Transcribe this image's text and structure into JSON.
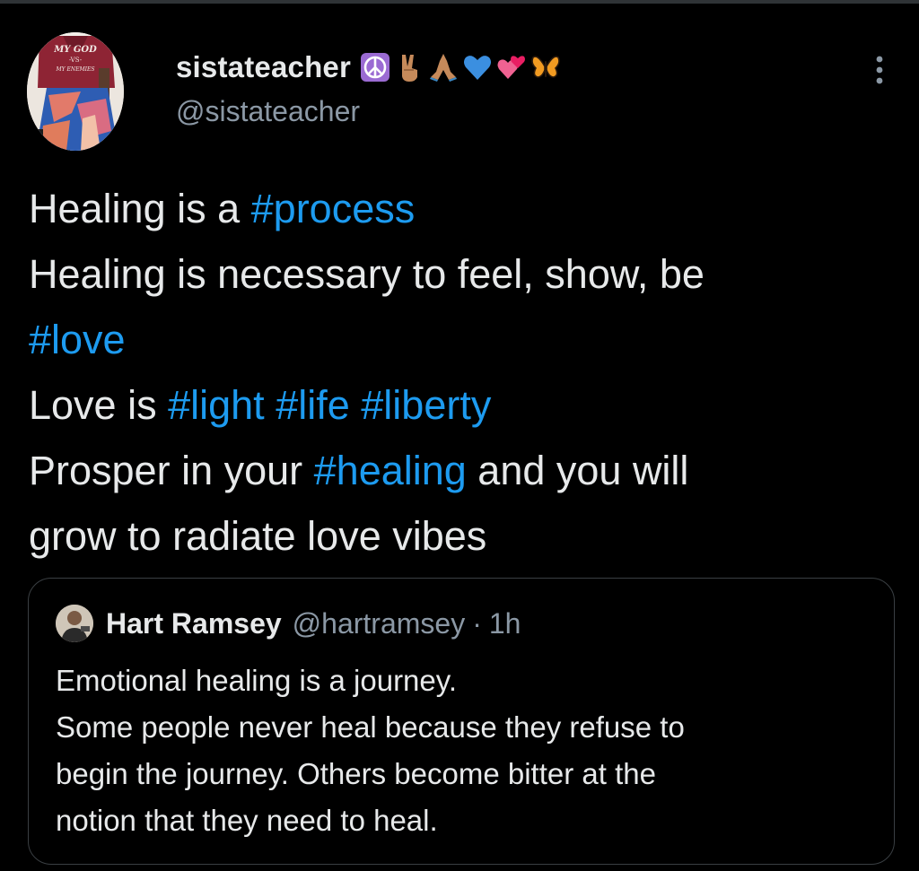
{
  "author": {
    "display_name": "sistateacher",
    "handle": "@sistateacher",
    "name_emojis": [
      "peace-symbol-icon",
      "victory-hand-icon",
      "folded-hands-icon",
      "blue-heart-icon",
      "two-hearts-icon",
      "butterfly-icon"
    ]
  },
  "tweet": {
    "lines": [
      [
        {
          "t": "Healing is a ",
          "tag": false
        },
        {
          "t": "#process",
          "tag": true
        }
      ],
      [
        {
          "t": "Healing is necessary to feel, show, be",
          "tag": false
        }
      ],
      [
        {
          "t": "#love",
          "tag": true
        }
      ],
      [
        {
          "t": "Love is ",
          "tag": false
        },
        {
          "t": "#light",
          "tag": true
        },
        {
          "t": " ",
          "tag": false
        },
        {
          "t": "#life",
          "tag": true
        },
        {
          "t": " ",
          "tag": false
        },
        {
          "t": "#liberty",
          "tag": true
        }
      ],
      [
        {
          "t": "Prosper in your ",
          "tag": false
        },
        {
          "t": "#healing",
          "tag": true
        },
        {
          "t": " and you will",
          "tag": false
        }
      ],
      [
        {
          "t": "grow to radiate love vibes",
          "tag": false
        }
      ]
    ]
  },
  "quote": {
    "name": "Hart Ramsey",
    "handle": "@hartramsey",
    "separator": "·",
    "time": "1h",
    "lines": [
      "Emotional healing is a journey.",
      "Some people never heal because they refuse to",
      "begin the journey. Others become bitter at the",
      "notion that they need to heal."
    ]
  },
  "avatar": {
    "shirt_text": [
      "MY GOD",
      "-VS-",
      "MY ENEMIES"
    ]
  },
  "colors": {
    "background": "#000000",
    "text": "#e7e9ea",
    "secondary_text": "#8b98a5",
    "hashtag": "#1d9bf0",
    "border": "#3a3f43"
  }
}
